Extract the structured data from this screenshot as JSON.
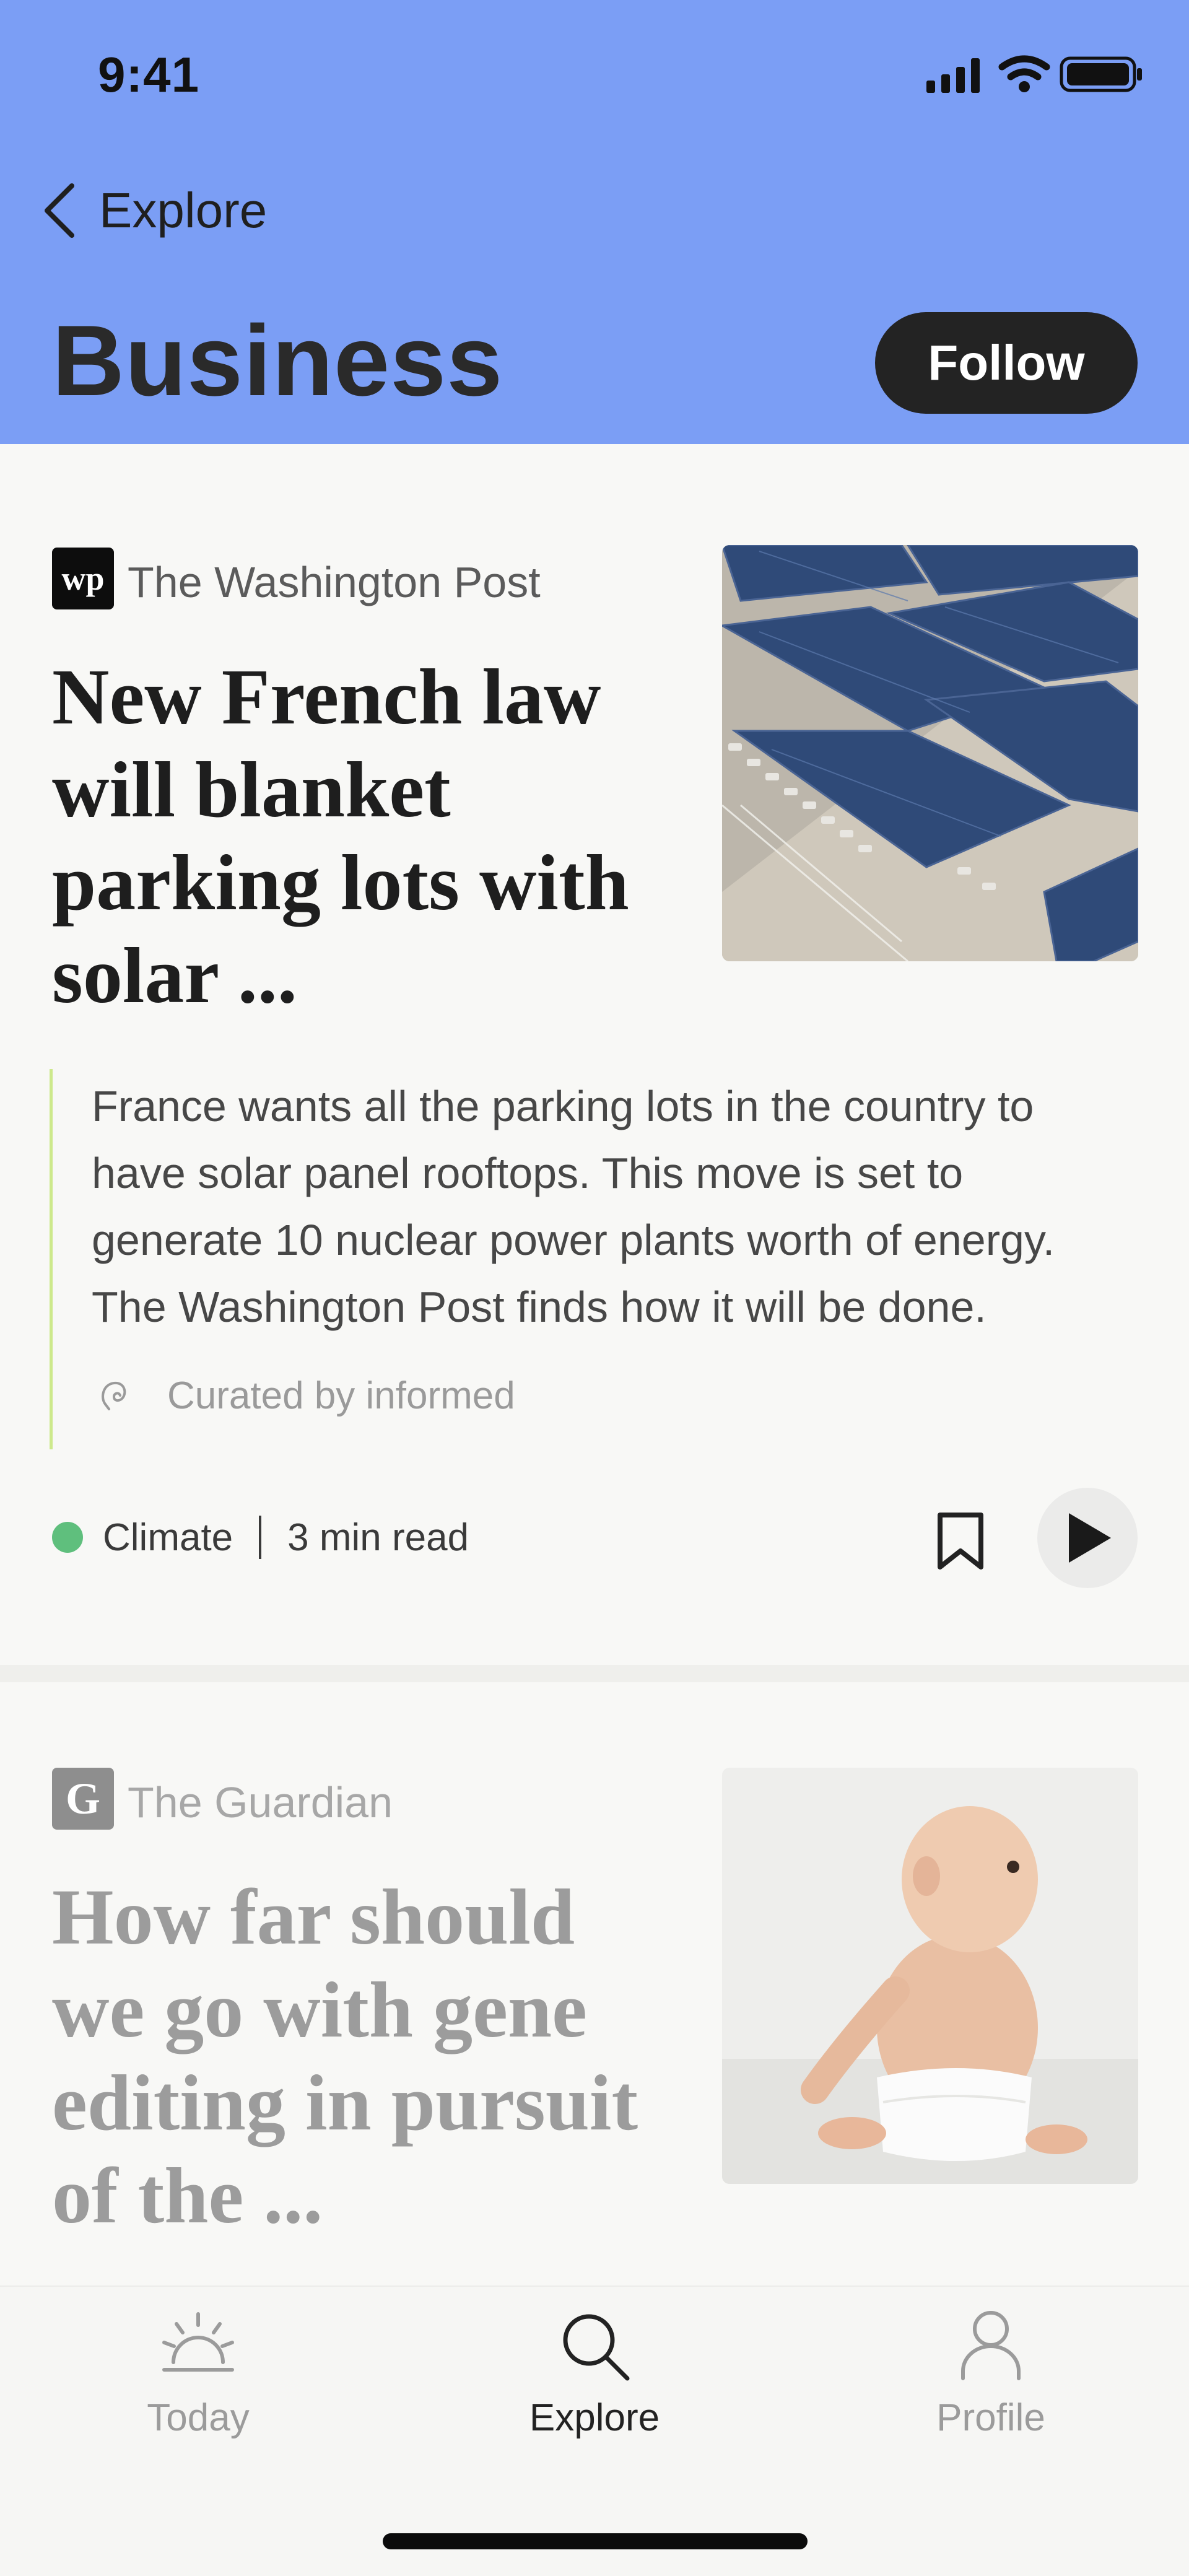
{
  "status_bar": {
    "time": "9:41"
  },
  "nav": {
    "back_label": "Explore"
  },
  "page": {
    "title": "Business",
    "follow_label": "Follow"
  },
  "articles": [
    {
      "publisher": "The Washington Post",
      "publisher_logo": "wp",
      "headline": "New French law will blanket parking lots with solar ...",
      "summary": "France wants all the parking lots in the country to have solar panel rooftops. This move is set to generate 10 nuclear power plants worth of energy. The Washington Post finds how it will be done.",
      "curated_by": "Curated by informed",
      "topic": "Climate",
      "topic_color": "#5fbf7d",
      "read_time": "3 min read",
      "image": "solar-panel-parking-lot"
    },
    {
      "publisher": "The Guardian",
      "publisher_logo": "G",
      "headline": "How far should we go with gene editing in pursuit of the ...",
      "image": "baby-sitting"
    }
  ],
  "tabbar": {
    "tabs": [
      {
        "label": "Today",
        "icon": "sunrise-icon",
        "active": false
      },
      {
        "label": "Explore",
        "icon": "search-icon",
        "active": true
      },
      {
        "label": "Profile",
        "icon": "person-icon",
        "active": false
      }
    ]
  },
  "colors": {
    "header_bg": "#7b9ef5",
    "follow_bg": "#232323",
    "accent_line": "#cde98c"
  }
}
